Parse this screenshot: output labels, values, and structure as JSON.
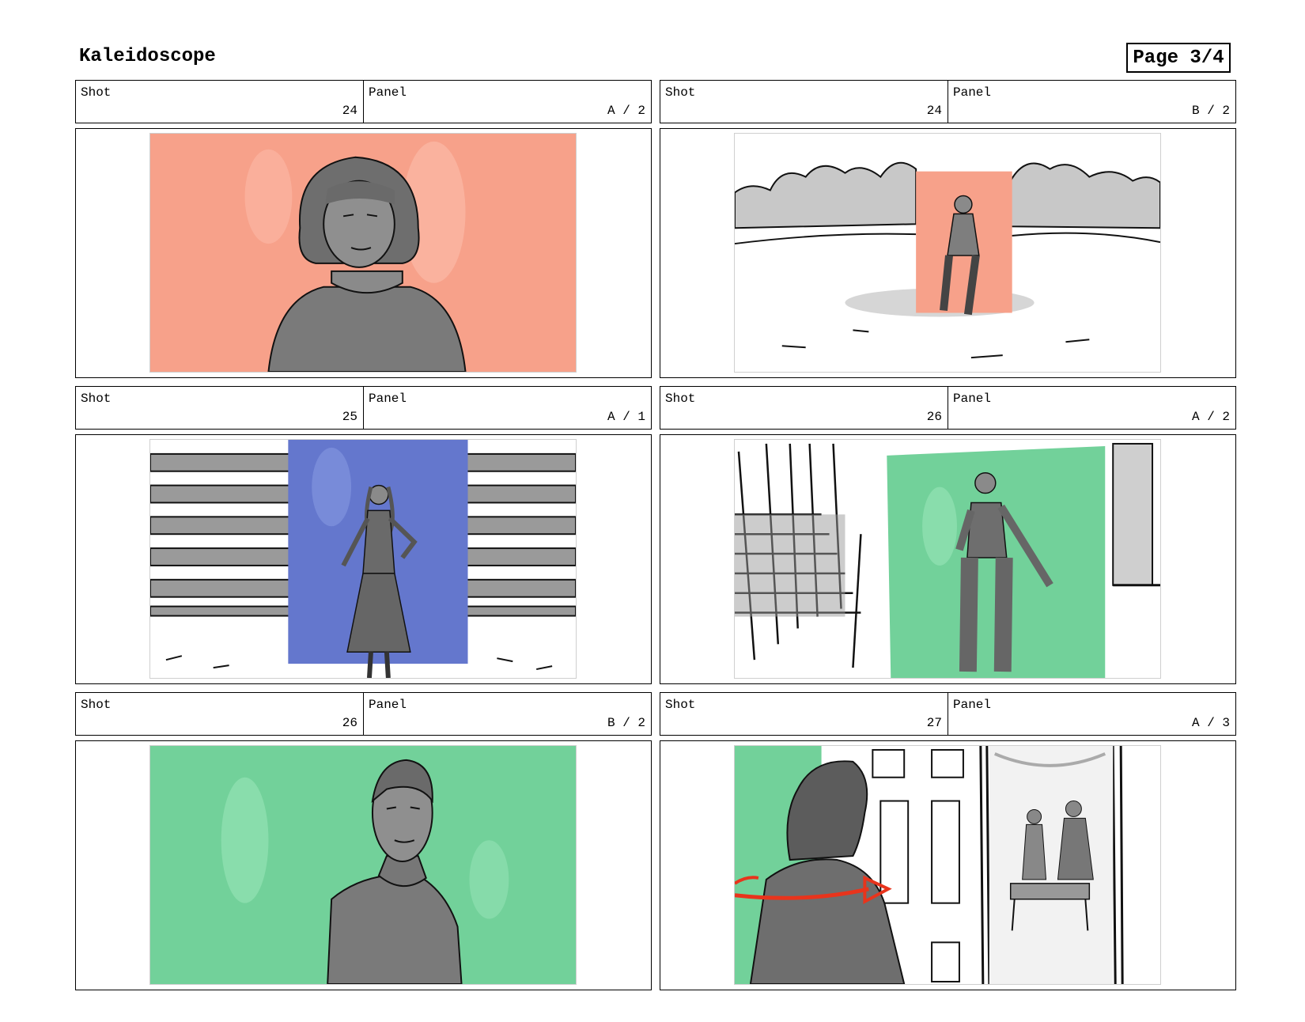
{
  "document": {
    "title": "Kaleidoscope",
    "page_label": "Page 3/4"
  },
  "labels": {
    "shot": "Shot",
    "panel": "Panel"
  },
  "panels": [
    {
      "shot": "24",
      "panel": "A / 2"
    },
    {
      "shot": "24",
      "panel": "B / 2"
    },
    {
      "shot": "25",
      "panel": "A / 1"
    },
    {
      "shot": "26",
      "panel": "A / 2"
    },
    {
      "shot": "26",
      "panel": "B / 2"
    },
    {
      "shot": "27",
      "panel": "A / 3"
    }
  ],
  "colors": {
    "coral_backdrop": "#f7a18a",
    "blue_backdrop": "#6477cd",
    "green_backdrop": "#72d19a",
    "figure_gray": "#777777",
    "arrow_red": "#e8341c"
  },
  "scenes": [
    {
      "icon": "close-up-woman-coral-backdrop"
    },
    {
      "icon": "woman-in-park-coral-backdrop"
    },
    {
      "icon": "woman-blue-backdrop-striped-wall"
    },
    {
      "icon": "woman-green-backdrop-staircase"
    },
    {
      "icon": "medium-shot-woman-green-backdrop"
    },
    {
      "icon": "man-doorway-red-arrow"
    }
  ]
}
